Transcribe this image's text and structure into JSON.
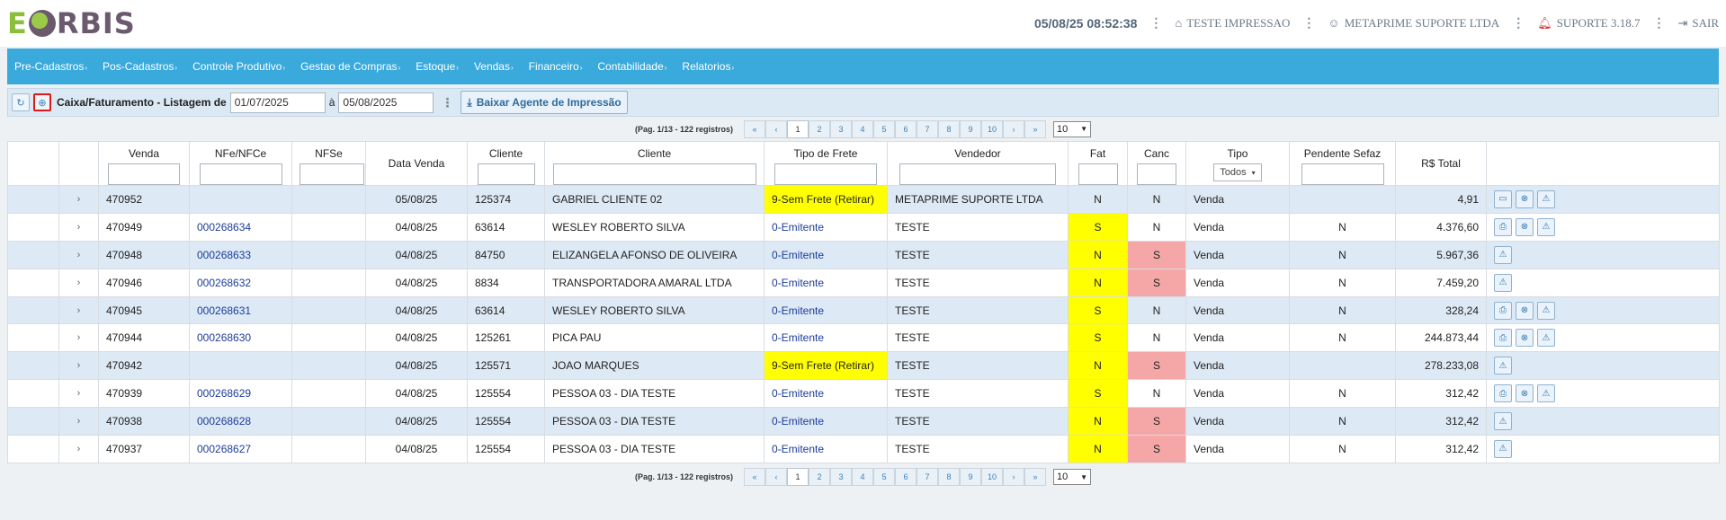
{
  "header": {
    "logo_e": "E",
    "logo_rest": "RBIS",
    "clock": "05/08/25 08:52:38",
    "printer": "TESTE IMPRESSAO",
    "user": "METAPRIME SUPORTE LTDA",
    "version": "SUPORTE 3.18.7",
    "logout": "SAIR"
  },
  "menu": [
    "Pre-Cadastros",
    "Pos-Cadastros",
    "Controle Produtivo",
    "Gestao de Compras",
    "Estoque",
    "Vendas",
    "Financeiro",
    "Contabilidade",
    "Relatorios"
  ],
  "toolbar": {
    "title": "Caixa/Faturamento - Listagem de",
    "date_from": "01/07/2025",
    "sep": "à",
    "date_to": "05/08/2025",
    "agent_label": "Baixar Agente de Impressão"
  },
  "pager": {
    "info": "(Pag. 1/13 - 122 registros)",
    "first": "«",
    "prev": "‹",
    "pages": [
      "1",
      "2",
      "3",
      "4",
      "5",
      "6",
      "7",
      "8",
      "9",
      "10"
    ],
    "next": "›",
    "last": "»",
    "page_size": "10"
  },
  "columns": [
    "",
    "",
    "Venda",
    "NFe/NFCe",
    "NFSe",
    "Data Venda",
    "Cliente",
    "Cliente",
    "Tipo de Frete",
    "Vendedor",
    "Fat",
    "Canc",
    "Tipo",
    "Pendente Sefaz",
    "R$ Total",
    ""
  ],
  "tipo_filter": "Todos",
  "rows": [
    {
      "venda": "470952",
      "nfe": "",
      "data": "05/08/25",
      "cod": "125374",
      "cliente": "GABRIEL CLIENTE 02",
      "frete": "9-Sem Frete (Retirar)",
      "vendedor": "METAPRIME SUPORTE LTDA",
      "fat": "N",
      "canc": "N",
      "tipo": "Venda",
      "pend": "",
      "total": "4,91",
      "acts": [
        "box",
        "cancel",
        "warn"
      ]
    },
    {
      "venda": "470949",
      "nfe": "000268634",
      "data": "04/08/25",
      "cod": "63614",
      "cliente": "WESLEY ROBERTO SILVA",
      "frete": "0-Emitente",
      "vendedor": "TESTE",
      "fat": "S",
      "canc": "N",
      "tipo": "Venda",
      "pend": "N",
      "total": "4.376,60",
      "acts": [
        "print",
        "cancel",
        "warn"
      ]
    },
    {
      "venda": "470948",
      "nfe": "000268633",
      "data": "04/08/25",
      "cod": "84750",
      "cliente": "ELIZANGELA AFONSO DE OLIVEIRA",
      "frete": "0-Emitente",
      "vendedor": "TESTE",
      "fat": "N",
      "canc": "S",
      "tipo": "Venda",
      "pend": "N",
      "total": "5.967,36",
      "acts": [
        "warn"
      ]
    },
    {
      "venda": "470946",
      "nfe": "000268632",
      "data": "04/08/25",
      "cod": "8834",
      "cliente": "TRANSPORTADORA AMARAL LTDA",
      "frete": "0-Emitente",
      "vendedor": "TESTE",
      "fat": "N",
      "canc": "S",
      "tipo": "Venda",
      "pend": "N",
      "total": "7.459,20",
      "acts": [
        "warn"
      ]
    },
    {
      "venda": "470945",
      "nfe": "000268631",
      "data": "04/08/25",
      "cod": "63614",
      "cliente": "WESLEY ROBERTO SILVA",
      "frete": "0-Emitente",
      "vendedor": "TESTE",
      "fat": "S",
      "canc": "N",
      "tipo": "Venda",
      "pend": "N",
      "total": "328,24",
      "acts": [
        "print",
        "cancel",
        "warn"
      ]
    },
    {
      "venda": "470944",
      "nfe": "000268630",
      "data": "04/08/25",
      "cod": "125261",
      "cliente": "PICA PAU",
      "frete": "0-Emitente",
      "vendedor": "TESTE",
      "fat": "S",
      "canc": "N",
      "tipo": "Venda",
      "pend": "N",
      "total": "244.873,44",
      "acts": [
        "print",
        "cancel",
        "warn"
      ]
    },
    {
      "venda": "470942",
      "nfe": "",
      "data": "04/08/25",
      "cod": "125571",
      "cliente": "JOAO MARQUES",
      "frete": "9-Sem Frete (Retirar)",
      "vendedor": "TESTE",
      "fat": "N",
      "canc": "S",
      "tipo": "Venda",
      "pend": "",
      "total": "278.233,08",
      "acts": [
        "warn"
      ]
    },
    {
      "venda": "470939",
      "nfe": "000268629",
      "data": "04/08/25",
      "cod": "125554",
      "cliente": "PESSOA 03 - DIA TESTE",
      "frete": "0-Emitente",
      "vendedor": "TESTE",
      "fat": "S",
      "canc": "N",
      "tipo": "Venda",
      "pend": "N",
      "total": "312,42",
      "acts": [
        "print",
        "cancel",
        "warn"
      ]
    },
    {
      "venda": "470938",
      "nfe": "000268628",
      "data": "04/08/25",
      "cod": "125554",
      "cliente": "PESSOA 03 - DIA TESTE",
      "frete": "0-Emitente",
      "vendedor": "TESTE",
      "fat": "N",
      "canc": "S",
      "tipo": "Venda",
      "pend": "N",
      "total": "312,42",
      "acts": [
        "warn"
      ]
    },
    {
      "venda": "470937",
      "nfe": "000268627",
      "data": "04/08/25",
      "cod": "125554",
      "cliente": "PESSOA 03 - DIA TESTE",
      "frete": "0-Emitente",
      "vendedor": "TESTE",
      "fat": "N",
      "canc": "S",
      "tipo": "Venda",
      "pend": "N",
      "total": "312,42",
      "acts": [
        "warn"
      ]
    }
  ],
  "colors": {
    "menu": "#3aa9dc",
    "yellow": "#ffff00",
    "pink": "#f5a7a7",
    "row_alt": "#dde9f5"
  }
}
